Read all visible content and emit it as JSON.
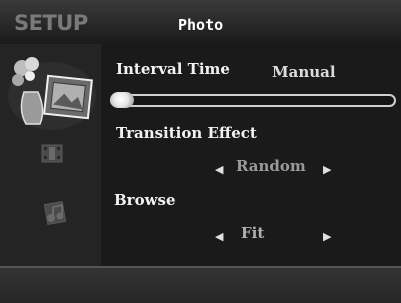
{
  "header": {
    "setup_label": "SETUP",
    "title": "Photo"
  },
  "sidebar": {
    "items": [
      {
        "icon": "photo-frame-icon",
        "selected": true
      },
      {
        "icon": "movie-icon",
        "selected": false
      },
      {
        "icon": "music-icon",
        "selected": false
      }
    ]
  },
  "settings": {
    "interval": {
      "label": "Interval Time",
      "value": "Manual",
      "slider_level": 0.0
    },
    "transition": {
      "label": "Transition Effect",
      "value": "Random"
    },
    "browse": {
      "label": "Browse",
      "value": "Fit"
    }
  },
  "arrows": {
    "left": "◀",
    "right": "▶"
  },
  "colors": {
    "background": "#1c1c1c",
    "text": "#f2f2f2",
    "dim_text": "#7a7a7a"
  }
}
